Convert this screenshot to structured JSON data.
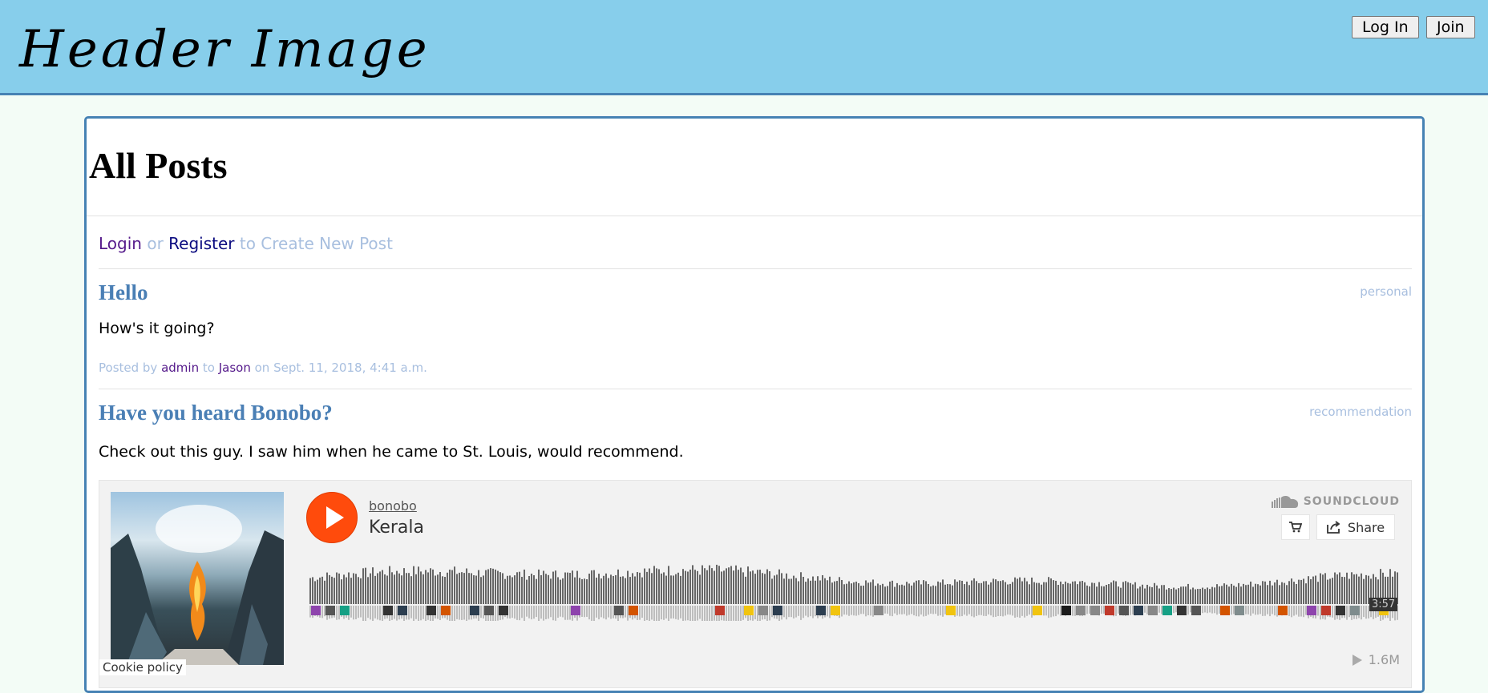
{
  "header": {
    "title_image_text": "Header Image",
    "login_label": "Log In",
    "join_label": "Join"
  },
  "page": {
    "title": "All Posts",
    "create": {
      "login_link": "Login",
      "or_text": "or",
      "register_link": "Register",
      "suffix_text": "to Create New Post"
    }
  },
  "posts": [
    {
      "title": "Hello",
      "tag": "personal",
      "body": "How's it going?",
      "meta": {
        "posted_by_text": "Posted by",
        "author": "admin",
        "to_text": "to",
        "recipient": "Jason",
        "on_text": "on Sept. 11, 2018, 4:41 a.m."
      }
    },
    {
      "title": "Have you heard Bonobo?",
      "tag": "recommendation",
      "body": "Check out this guy. I saw him when he came to St. Louis, would recommend."
    }
  ],
  "soundcloud": {
    "artist": "bonobo",
    "track": "Kerala",
    "brand": "SOUNDCLOUD",
    "share_label": "Share",
    "duration": "3:57",
    "plays": "1.6M"
  },
  "cookie_policy": "Cookie policy",
  "colors": {
    "header_bg": "#87ceeb",
    "accent": "#4682b4",
    "soundcloud_orange": "#ff4b0c"
  }
}
